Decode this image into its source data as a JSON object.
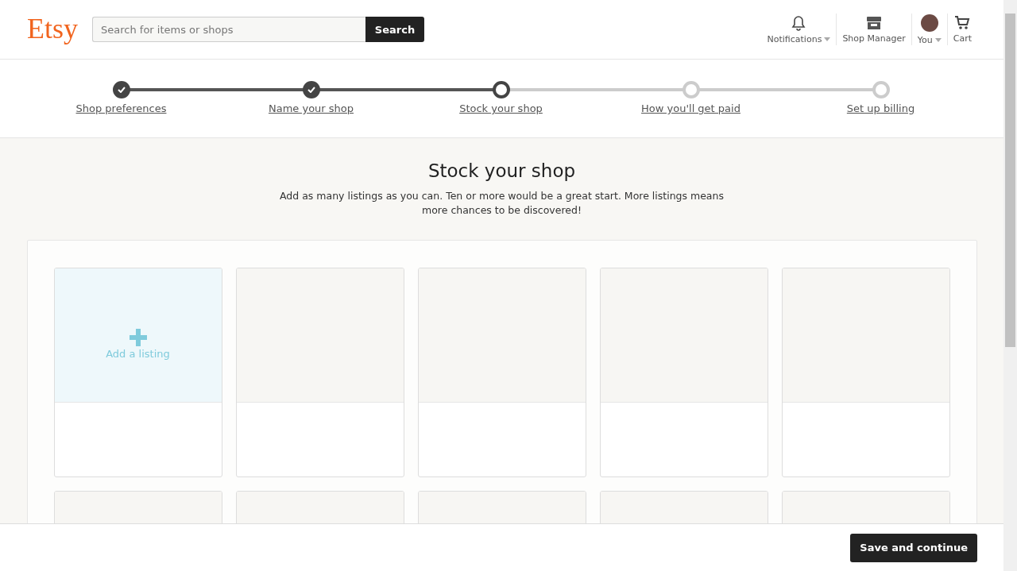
{
  "header": {
    "logo": "Etsy",
    "search": {
      "placeholder": "Search for items or shops",
      "button": "Search"
    },
    "nav": [
      {
        "kind": "bell",
        "label": "Notifications",
        "dropdown": true
      },
      {
        "kind": "shop",
        "label": "Shop Manager",
        "dropdown": false
      },
      {
        "kind": "avatar",
        "label": "You",
        "dropdown": true
      },
      {
        "kind": "cart",
        "label": "Cart",
        "dropdown": false
      }
    ]
  },
  "steps": [
    {
      "label": "Shop preferences",
      "completed": true,
      "selected": false
    },
    {
      "label": "Name your shop",
      "completed": true,
      "selected": false
    },
    {
      "label": "Stock your shop",
      "completed": false,
      "selected": true
    },
    {
      "label": "How you'll get paid",
      "completed": false,
      "selected": false
    },
    {
      "label": "Set up billing",
      "completed": false,
      "selected": false
    }
  ],
  "title": "Stock your shop",
  "subtitle": "Add as many listings as you can. Ten or more would be a great start. More listings means more chances to be discovered!",
  "slots": [
    {
      "kind": "add",
      "label": "Add a listing"
    },
    {
      "kind": "empty"
    },
    {
      "kind": "empty"
    },
    {
      "kind": "empty"
    },
    {
      "kind": "empty"
    },
    {
      "kind": "empty"
    },
    {
      "kind": "empty"
    },
    {
      "kind": "empty"
    },
    {
      "kind": "empty"
    },
    {
      "kind": "empty"
    }
  ],
  "footer": {
    "button": "Save and continue"
  }
}
